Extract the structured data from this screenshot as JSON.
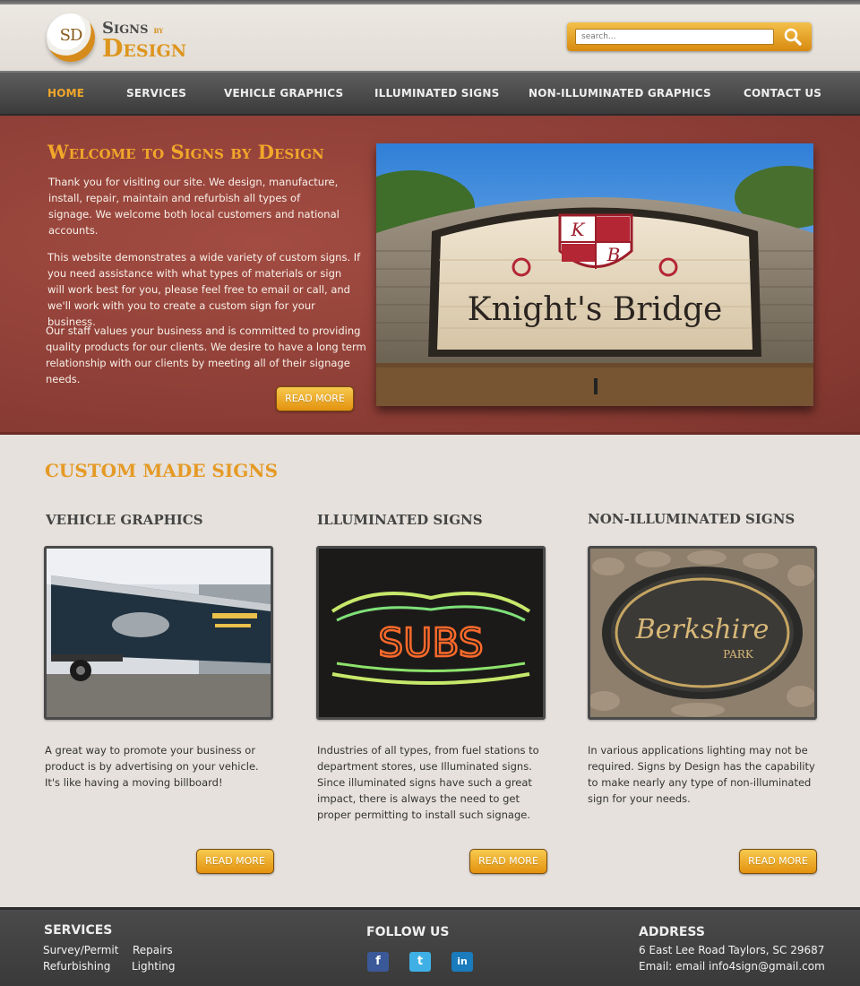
{
  "brand": {
    "logo_badge": "SD",
    "logo_signs": "Signs",
    "logo_by": "by",
    "logo_design": "Design",
    "accent_color": "#f0a62a"
  },
  "search": {
    "placeholder": "search...",
    "icon": "magnifier-icon"
  },
  "nav": {
    "items": [
      {
        "label": "HOME",
        "active": true
      },
      {
        "label": "SERVICES"
      },
      {
        "label": "VEHICLE GRAPHICS"
      },
      {
        "label": "ILLUMINATED SIGNS"
      },
      {
        "label": "NON-ILLUMINATED GRAPHICS"
      },
      {
        "label": "CONTACT US"
      }
    ]
  },
  "hero": {
    "title": "Welcome to Signs by Design",
    "p1": "Thank you for visiting our site. We design, manufacture, install, repair, maintain and refurbish all types of signage. We welcome both local customers and national accounts.",
    "p2": "This website demonstrates a wide variety of custom signs. If you need assistance with what types of materials or sign will work best for you, please feel free to email or  call, and we'll work with you to create a custom sign for your business.",
    "p3": "Our staff values your business and is committed to providing quality products for our clients. We desire to have a long term relationship with our clients by meeting all of their signage needs.",
    "button": "READ MORE",
    "image_sign_text": "Knight's Bridge",
    "image_crest_letters": [
      "K",
      "B"
    ]
  },
  "custom": {
    "title": "CUSTOM MADE SIGNS",
    "columns": [
      {
        "title": "VEHICLE GRAPHICS",
        "text": "A great way to promote your business or product is by advertising on your vehicle. It's like having a moving billboard!",
        "button": "READ MORE"
      },
      {
        "title": "ILLUMINATED SIGNS",
        "text": "Industries of all types, from fuel stations to department stores, use Illuminated signs. Since illuminated signs have such a great impact, there is always  the need to get proper permitting to install such signage.",
        "button": "READ MORE",
        "image_sign_text": "SUBS"
      },
      {
        "title": "NON-ILLUMINATED SIGNS",
        "text": "In various applications lighting may not be required. Signs by Design has the capability to make nearly any type of non-illuminated sign for your needs.",
        "button": "READ MORE",
        "image_sign_text": "Berkshire",
        "image_sign_subtext": "PARK"
      }
    ]
  },
  "footer": {
    "services": {
      "heading": "SERVICES",
      "links": [
        "Survey/Permit",
        "Repairs",
        "Refurbishing",
        "Lighting"
      ]
    },
    "follow": {
      "heading": "FOLLOW US",
      "icons": [
        {
          "name": "facebook-icon",
          "glyph": "f",
          "color": "#3b5998"
        },
        {
          "name": "twitter-icon",
          "glyph": "t",
          "color": "#3fb0e6"
        },
        {
          "name": "linkedin-icon",
          "glyph": "in",
          "color": "#1a7bbd"
        }
      ]
    },
    "address": {
      "heading": "ADDRESS",
      "line1": "6 East Lee Road Taylors, SC 29687",
      "line2": "Email: email info4sign@gmail.com"
    }
  }
}
